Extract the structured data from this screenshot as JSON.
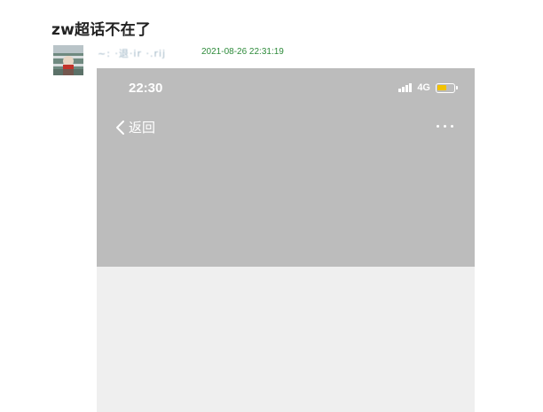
{
  "post": {
    "title": "zw超话不在了",
    "author": "~: ·退·ir    ·.rij",
    "timestamp": "2021-08-26 22:31:19"
  },
  "screenshot": {
    "status_bar": {
      "time": "22:30",
      "network": "4G",
      "battery_level": 0.6,
      "battery_color": "#f2c200"
    },
    "nav": {
      "back_label": "返回",
      "back_icon": "chevron-left-icon",
      "more_icon": "more-dots-icon"
    },
    "colors": {
      "header_bg": "#bcbcbc",
      "body_bg": "#efefef"
    }
  }
}
